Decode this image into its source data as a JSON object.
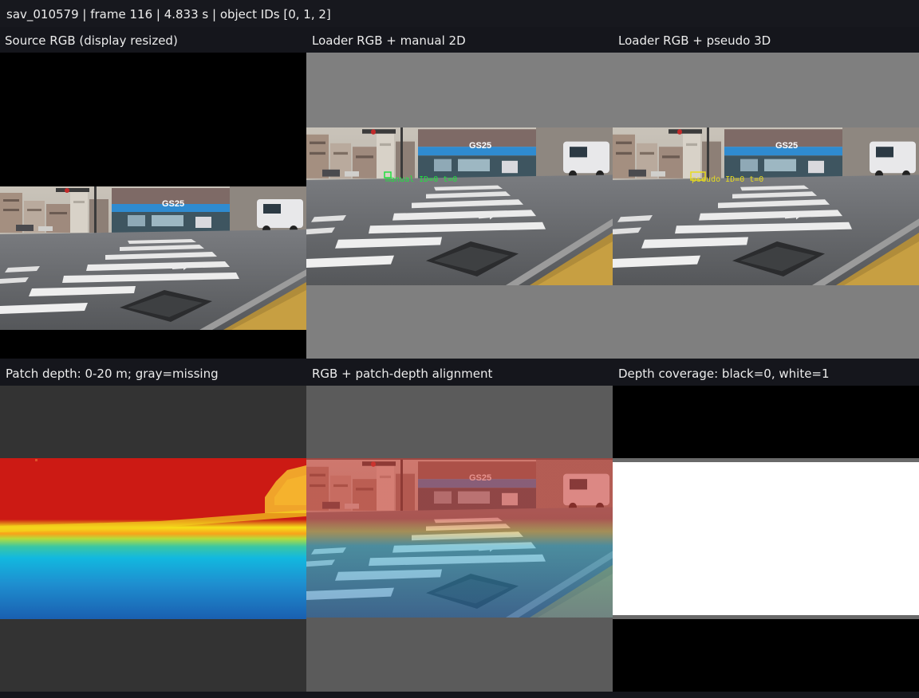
{
  "header": {
    "title": "sav_010579 | frame 116 | 4.833 s | object IDs [0, 1, 2]"
  },
  "panels": [
    {
      "label": "Source RGB (display resized)"
    },
    {
      "label": "Loader RGB + manual 2D"
    },
    {
      "label": "Loader RGB + pseudo 3D"
    },
    {
      "label": "Patch depth: 0-20 m; gray=missing"
    },
    {
      "label": "RGB + patch-depth alignment"
    },
    {
      "label": "Depth coverage: black=0, white=1"
    }
  ],
  "annotations": {
    "manual": "manual ID=0 t=0",
    "pseudo": "pseudo ID=0 t=0"
  },
  "scene": {
    "store_sign": "GS25"
  },
  "colors": {
    "manual_box": "#22e040",
    "pseudo_box": "#e8dc1e",
    "depth_near": "#1a5fb0",
    "depth_far": "#cc1a14",
    "missing_gray": "#333333"
  }
}
